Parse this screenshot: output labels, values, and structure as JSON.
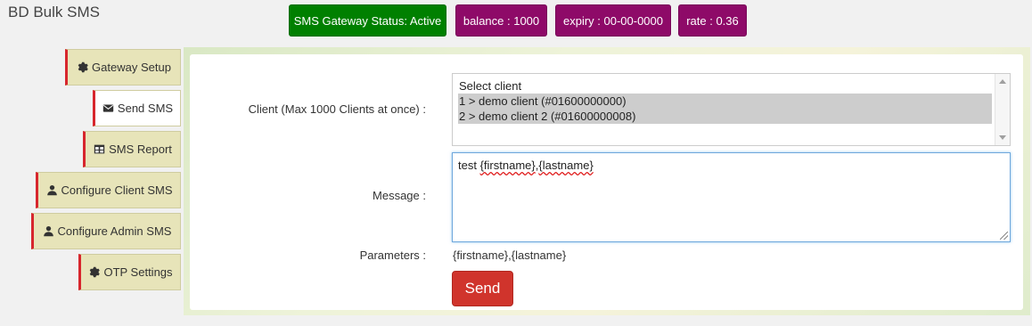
{
  "app": {
    "title": "BD Bulk SMS"
  },
  "status": {
    "gateway": "SMS Gateway Status: Active",
    "balance": "balance : 1000",
    "expiry": "expiry : 00-00-0000",
    "rate": "rate : 0.36"
  },
  "sidebar": {
    "items": [
      {
        "label": "Gateway Setup",
        "icon": "gear-icon"
      },
      {
        "label": "Send SMS",
        "icon": "envelope-icon"
      },
      {
        "label": "SMS Report",
        "icon": "table-icon"
      },
      {
        "label": "Configure Client SMS",
        "icon": "user-icon"
      },
      {
        "label": "Configure Admin SMS",
        "icon": "user-icon"
      },
      {
        "label": "OTP Settings",
        "icon": "gear-icon"
      }
    ],
    "active": "Send SMS"
  },
  "form": {
    "client_label": "Client (Max 1000 Clients at once) :",
    "client_options": [
      "Select client",
      "1 > demo client (#01600000000)",
      "2 > demo client 2 (#01600000008)"
    ],
    "message_label": "Message :",
    "message_prefix": "test ",
    "message_word1": "{firstname}",
    "message_sep": ",",
    "message_word2": "{lastname}",
    "params_label": "Parameters :",
    "params_value": "{firstname},{lastname}",
    "send_label": "Send"
  },
  "colors": {
    "status_green": "#008000",
    "badge_magenta": "#8e0a68",
    "nav_bg": "#e7e4b9",
    "nav_accent": "#d7262d",
    "send_red": "#d0342c"
  }
}
